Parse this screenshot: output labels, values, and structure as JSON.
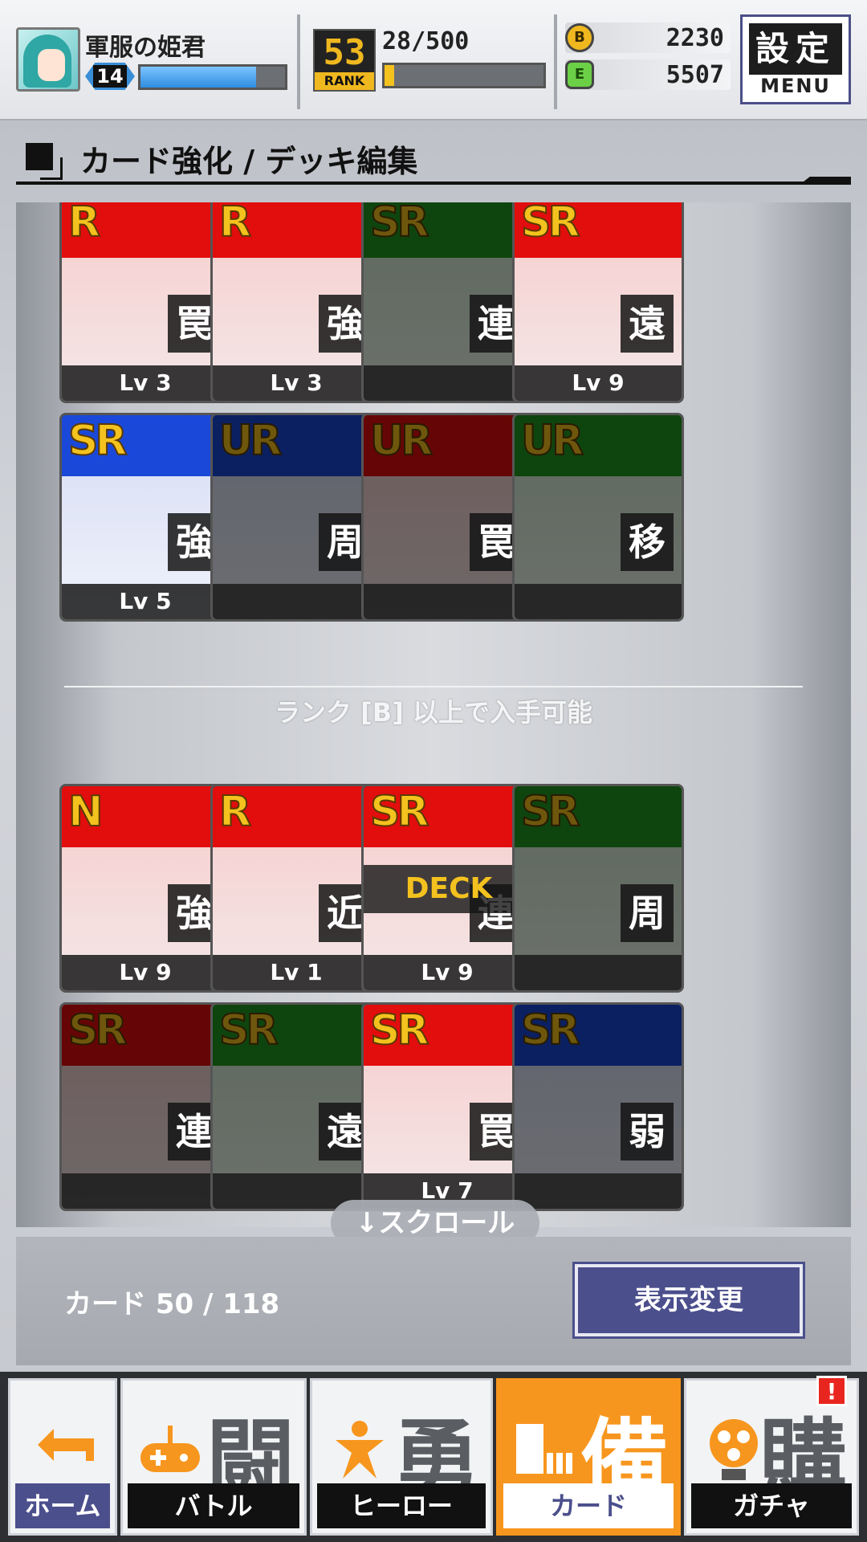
{
  "header": {
    "player_name": "軍服の姫君",
    "level": "14",
    "exp_fill": 0.8,
    "rank": "53",
    "rank_label": "RANK",
    "rank_exp": "28/500",
    "rank_fill": 0.06,
    "coins": "2230",
    "coin_icon": "B",
    "energy": "5507",
    "energy_icon": "E",
    "settings_kanji": "設定",
    "settings_menu": "MENU"
  },
  "section": {
    "title": "カード強化 / デッキ編集"
  },
  "cards_top": [
    {
      "rarity": "R",
      "type": "罠",
      "level": "Lv 3",
      "color": "red",
      "dim": false
    },
    {
      "rarity": "R",
      "type": "強",
      "level": "Lv 3",
      "color": "red",
      "dim": false
    },
    {
      "rarity": "SR",
      "type": "連",
      "level": "",
      "color": "green",
      "dim": true
    },
    {
      "rarity": "SR",
      "type": "遠",
      "level": "Lv 9",
      "color": "red",
      "dim": false
    },
    {
      "rarity": "SR",
      "type": "強",
      "level": "Lv 5",
      "color": "blue",
      "dim": false
    },
    {
      "rarity": "UR",
      "type": "周",
      "level": "",
      "color": "blue",
      "dim": true
    },
    {
      "rarity": "UR",
      "type": "罠",
      "level": "",
      "color": "red",
      "dim": true
    },
    {
      "rarity": "UR",
      "type": "移",
      "level": "",
      "color": "green",
      "dim": true
    }
  ],
  "unlock_text": "ランク [B] 以上で入手可能",
  "cards_bottom": [
    {
      "rarity": "N",
      "type": "強",
      "level": "Lv 9",
      "color": "red",
      "dim": false,
      "deck": ""
    },
    {
      "rarity": "R",
      "type": "近",
      "level": "Lv 1",
      "color": "red",
      "dim": false,
      "deck": ""
    },
    {
      "rarity": "SR",
      "type": "連",
      "level": "Lv 9",
      "color": "red",
      "dim": false,
      "deck": "DECK"
    },
    {
      "rarity": "SR",
      "type": "周",
      "level": "",
      "color": "green",
      "dim": true,
      "deck": ""
    },
    {
      "rarity": "SR",
      "type": "連",
      "level": "",
      "color": "red",
      "dim": true,
      "deck": ""
    },
    {
      "rarity": "SR",
      "type": "遠",
      "level": "",
      "color": "green",
      "dim": true,
      "deck": ""
    },
    {
      "rarity": "SR",
      "type": "罠",
      "level": "Lv 7",
      "color": "red",
      "dim": false,
      "deck": ""
    },
    {
      "rarity": "SR",
      "type": "弱",
      "level": "",
      "color": "blue",
      "dim": true,
      "deck": ""
    }
  ],
  "scroll_hint": "↓スクロール",
  "footer": {
    "card_count": "カード 50 / 118",
    "view_button": "表示変更"
  },
  "nav": {
    "tabs": [
      {
        "glyph": "",
        "label": "ホーム",
        "icon": "back-arrow-icon"
      },
      {
        "glyph": "闘",
        "label": "バトル",
        "icon": "gamepad-icon"
      },
      {
        "glyph": "勇",
        "label": "ヒーロー",
        "icon": "hero-icon"
      },
      {
        "glyph": "備",
        "label": "カード",
        "icon": "card-stack-icon"
      },
      {
        "glyph": "購",
        "label": "ガチャ",
        "icon": "gacha-icon"
      }
    ],
    "alert": "!"
  },
  "colors": {
    "accent": "#f7961e",
    "nav_blue": "#4b4f8c",
    "rank_gold": "#f4c21e"
  }
}
